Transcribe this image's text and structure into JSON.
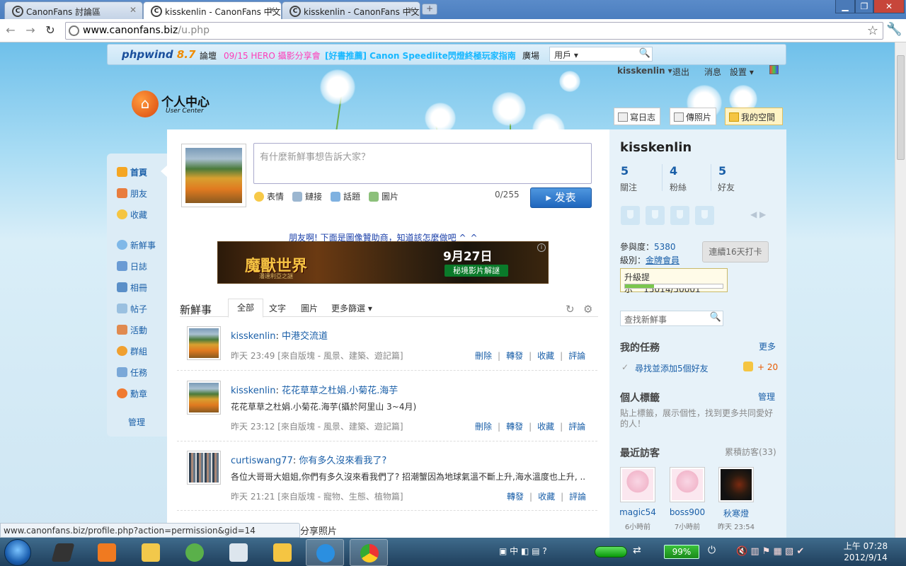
{
  "browser": {
    "tabs": [
      {
        "title": "CanonFans 討論區"
      },
      {
        "title": "kisskenlin - CanonFans 中文..."
      },
      {
        "title": "kisskenlin - CanonFans 中文..."
      }
    ],
    "url_domain": "www.canonfans.biz",
    "url_path": "/u.php",
    "status_url": "www.canonfans.biz/profile.php?action=permission&gid=14"
  },
  "forum_nav": {
    "logo_main": "phpwind",
    "logo_version": "8.7",
    "items": [
      "論壇",
      "09/15 HERO 攝影分享會",
      "[好書推薦] Canon Speedlite閃燈終極玩家指南",
      "廣場"
    ],
    "search_scope": "用戶",
    "colors": {
      "hero": "#ff3bb8",
      "book": "#19b8ff"
    }
  },
  "userbar": {
    "username": "kisskenlin",
    "logout": "退出",
    "messages": "消息",
    "settings": "設置"
  },
  "user_center": {
    "title": "个人中心",
    "subtitle": "User Center"
  },
  "left_nav": [
    {
      "label": "首頁",
      "icon": "home-icon"
    },
    {
      "label": "朋友",
      "icon": "friends-icon"
    },
    {
      "label": "收藏",
      "icon": "star-icon"
    },
    {
      "label": "新鮮事",
      "icon": "bubble-icon"
    },
    {
      "label": "日誌",
      "icon": "notebook-icon"
    },
    {
      "label": "相冊",
      "icon": "album-icon"
    },
    {
      "label": "帖子",
      "icon": "post-icon"
    },
    {
      "label": "活動",
      "icon": "activity-icon"
    },
    {
      "label": "群組",
      "icon": "group-icon"
    },
    {
      "label": "任務",
      "icon": "task-icon"
    },
    {
      "label": "勳章",
      "icon": "medal-icon"
    },
    {
      "label": "管理",
      "icon": ""
    }
  ],
  "composer": {
    "placeholder": "有什麼新鮮事想告訴大家？",
    "tools": [
      "表情",
      "鏈接",
      "話題",
      "圖片"
    ],
    "counter": "0/255",
    "submit": "发表"
  },
  "ad": {
    "text": "朋友啊! 下面是圖像贊助商，知道該怎麼做吧 ^_^",
    "banner_title": "魔獸世界",
    "banner_sub": "潘達利亞之謎",
    "banner_date": "9月27日",
    "banner_video": "秘境影片解謎"
  },
  "feed": {
    "title": "新鮮事",
    "tabs": [
      "全部",
      "文字",
      "圖片",
      "更多篩選"
    ],
    "items": [
      {
        "user": "kisskenlin",
        "title": "中港交流道",
        "body": "",
        "meta": "昨天 23:49 [來自版塊 - 風景、建築、遊記篇]",
        "actions": [
          "刪除",
          "轉發",
          "收藏",
          "評論"
        ]
      },
      {
        "user": "kisskenlin",
        "title": "花花草草之杜娟.小菊花.海芋",
        "body": "花花草草之杜娟.小菊花.海芋(攝於阿里山 3~4月)",
        "meta": "昨天 23:12 [來自版塊 - 風景、建築、遊記篇]",
        "actions": [
          "刪除",
          "轉發",
          "收藏",
          "評論"
        ]
      },
      {
        "user": "curtiswang77",
        "title": "你有多久沒來看我了?",
        "body": "各位大哥哥大姐姐,你們有多久沒來看我們了? 招潮蟹因為地球氣溫不斷上升,海水溫度也上升, ..",
        "meta": "昨天 21:21 [來自版塊 - 寵物、生態、植物篇]",
        "actions": [
          "轉發",
          "收藏",
          "評論"
        ]
      }
    ],
    "partial_next": "分享照片"
  },
  "profile": {
    "top_buttons": [
      "寫日志",
      "傳照片",
      "我的空間"
    ],
    "name": "kisskenlin",
    "stats": [
      {
        "value": "5",
        "label": "關注"
      },
      {
        "value": "4",
        "label": "粉絲"
      },
      {
        "value": "5",
        "label": "好友"
      }
    ],
    "participation_label": "參與度：",
    "participation_value": "5380",
    "level_label": "級別：",
    "level_value": "金牌會員",
    "checkin": "連續16天打卡",
    "upgrade_label": "升級提示",
    "upgrade_value": "15014/50001",
    "upgrade_progress": 0.3,
    "search_placeholder": "查找新鮮事",
    "tasks_title": "我的任務",
    "tasks_more": "更多",
    "task_item": "尋找並添加5個好友",
    "task_reward": "+ 20",
    "tags_title": "個人標籤",
    "tags_manage": "管理",
    "tags_text": "貼上標籤，展示個性，找到更多共同愛好的人！",
    "visitors_title": "最近訪客",
    "visitors_total": "累積訪客(33)",
    "visitors": [
      {
        "name": "magic54",
        "time": "6小時前"
      },
      {
        "name": "boss900",
        "time": "7小時前"
      },
      {
        "name": "秋寒燈",
        "time": "昨天 23:54"
      }
    ]
  },
  "taskbar": {
    "battery": "99%",
    "ime": "中",
    "time": "上午 07:28",
    "date": "2012/9/14"
  }
}
